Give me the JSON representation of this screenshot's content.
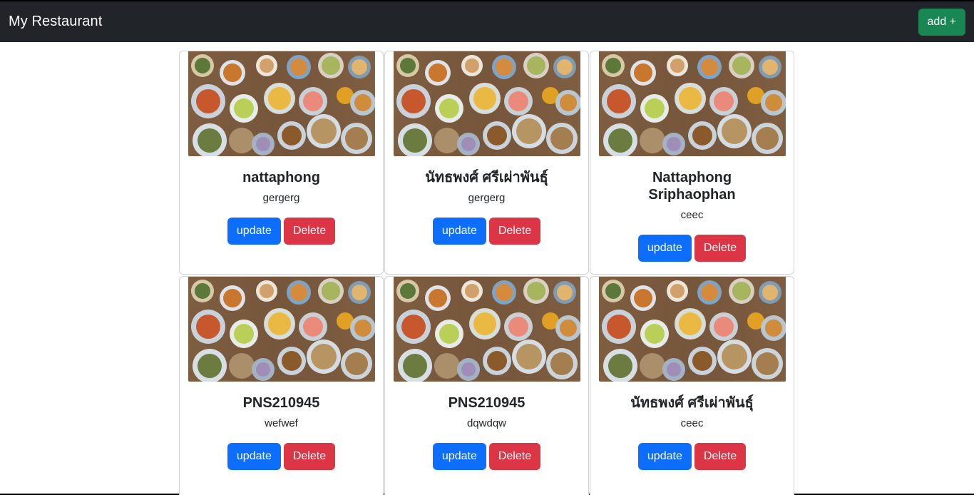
{
  "navbar": {
    "brand": "My Restaurant",
    "add_label": "add +"
  },
  "cards": [
    {
      "title": "nattaphong",
      "text": "gergerg",
      "update_label": "update",
      "delete_label": "Delete"
    },
    {
      "title": "นัทธพงศ์ ศรีเผ่าพันธุ์",
      "text": "gergerg",
      "update_label": "update",
      "delete_label": "Delete"
    },
    {
      "title": "Nattaphong Sriphaophan",
      "text": "ceec",
      "update_label": "update",
      "delete_label": "Delete"
    },
    {
      "title": "PNS210945",
      "text": "wefwef",
      "update_label": "update",
      "delete_label": "Delete"
    },
    {
      "title": "PNS210945",
      "text": "dqwdqw",
      "update_label": "update",
      "delete_label": "Delete"
    },
    {
      "title": "นัทธพงศ์ ศรีเผ่าพันธุ์",
      "text": "ceec",
      "update_label": "update",
      "delete_label": "Delete"
    }
  ],
  "colors": {
    "navbar_bg": "#212529",
    "add_button": "#198754",
    "update_button": "#0d6efd",
    "delete_button": "#dc3545"
  }
}
